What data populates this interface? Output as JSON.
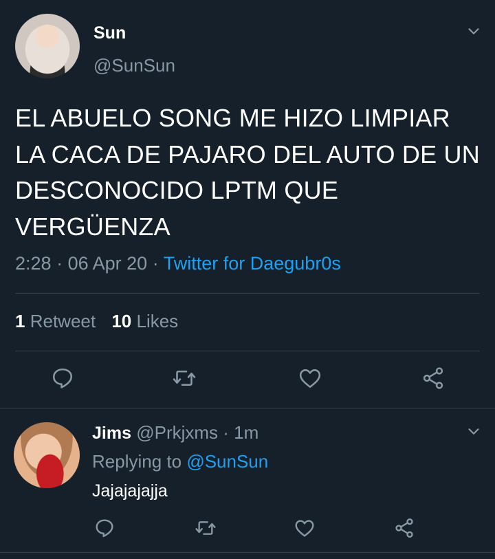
{
  "tweet": {
    "author_name": "Sun",
    "author_handle": "@SunSun",
    "text": "EL ABUELO SONG ME HIZO LIMPIAR LA CACA DE PAJARO DEL AUTO DE UN DESCONOCIDO LPTM QUE VERGÜENZA",
    "time": "2:28",
    "date": "06 Apr 20",
    "meta_sep": "·",
    "source": "Twitter for Daegubr0s",
    "retweet_count": "1",
    "retweet_label": "Retweet",
    "like_count": "10",
    "like_label": "Likes"
  },
  "reply": {
    "author_name": "Jims",
    "author_handle": "@Prkjxms",
    "age": "· 1m",
    "replying_to_label": "Replying to",
    "replying_to_handle": "@SunSun",
    "text": "Jajajajajja"
  },
  "icons": [
    "chevron-down-icon",
    "reply-icon",
    "retweet-icon",
    "like-icon",
    "share-icon"
  ],
  "colors": {
    "background": "#15202b",
    "text": "#ffffff",
    "muted": "#8899a6",
    "link": "#1da1f2",
    "divider": "#38444d"
  }
}
